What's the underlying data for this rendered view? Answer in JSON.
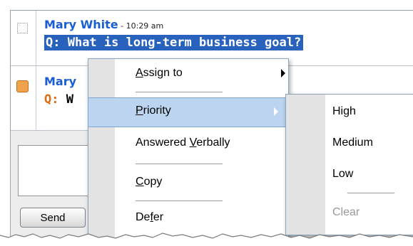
{
  "messages": [
    {
      "sender": "Mary White",
      "separator": " - ",
      "time": "10:29 am",
      "question_prefix": "Q:",
      "question_text": " What is long-term business goal?",
      "selected": true,
      "status": "unanswered"
    },
    {
      "sender": "Mary",
      "question_prefix": "Q:",
      "question_text": " W",
      "selected": false,
      "status": "priority-flagged"
    }
  ],
  "input": {
    "value": "",
    "send_label": "Send"
  },
  "context_menu": {
    "items": [
      {
        "label_underlined": "A",
        "label_rest": "ssign to",
        "has_submenu": true
      },
      {
        "label_underlined": "P",
        "label_rest": "riority",
        "has_submenu": true,
        "highlighted": true
      },
      {
        "label_before": "Answered ",
        "label_underlined": "V",
        "label_rest": "erbally"
      },
      {
        "label_underlined": "C",
        "label_rest": "opy"
      },
      {
        "label_before": "De",
        "label_underlined": "f",
        "label_rest": "er"
      }
    ]
  },
  "priority_submenu": {
    "items": [
      {
        "label": "High"
      },
      {
        "label": "Medium"
      },
      {
        "label": "Low"
      },
      {
        "label": "Clear",
        "disabled": true
      }
    ]
  },
  "colors": {
    "sender": "#1a5fd1",
    "selection": "#2962bd",
    "question_prefix": "#e06a10",
    "menu_highlight": "#bcd4f0",
    "priority_flag": "#f0a24c"
  }
}
